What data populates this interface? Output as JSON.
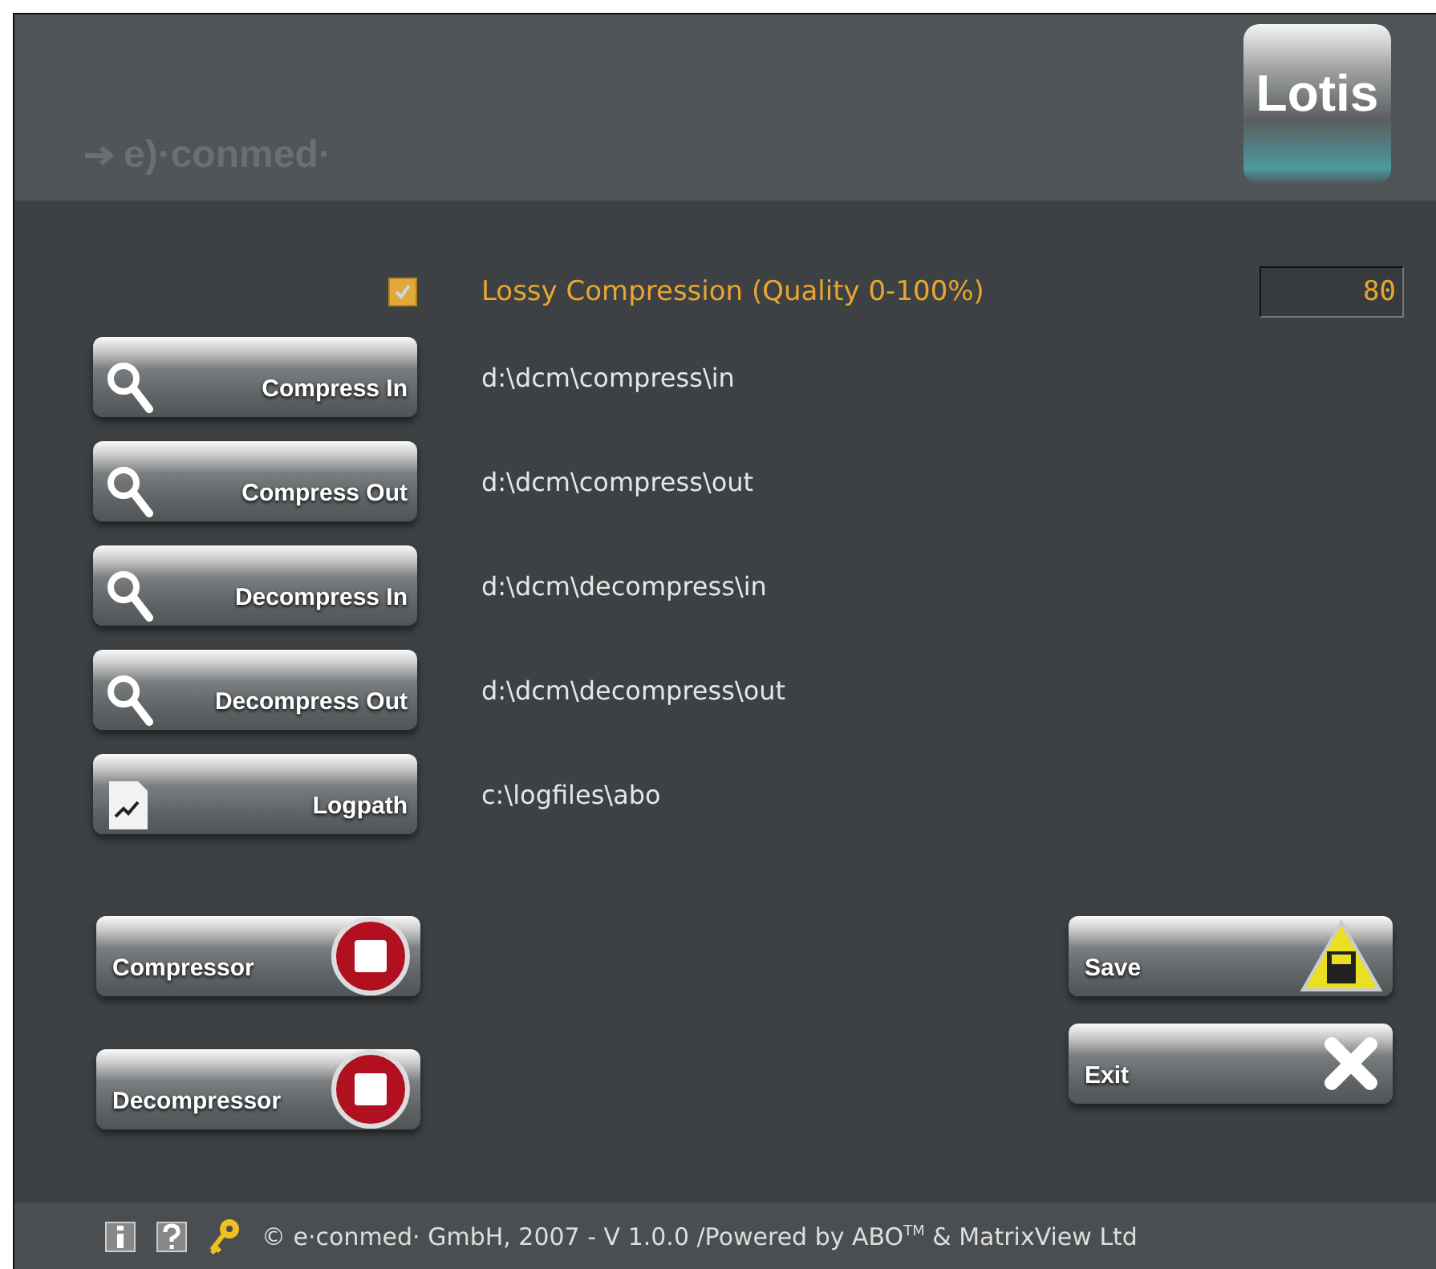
{
  "header": {
    "logo": "e)·conmed·",
    "app_badge": "Lotis"
  },
  "quality": {
    "checked": true,
    "label": "Lossy Compression (Quality 0-100%)",
    "value": "80"
  },
  "paths": [
    {
      "button": "Compress In",
      "kind": "search",
      "path": "d:\\dcm\\compress\\in"
    },
    {
      "button": "Compress Out",
      "kind": "search",
      "path": "d:\\dcm\\compress\\out"
    },
    {
      "button": "Decompress In",
      "kind": "search",
      "path": "d:\\dcm\\decompress\\in"
    },
    {
      "button": "Decompress Out",
      "kind": "search",
      "path": "d:\\dcm\\decompress\\out"
    },
    {
      "button": "Logpath",
      "kind": "log",
      "path": "c:\\logfiles\\abo"
    }
  ],
  "services": [
    {
      "label": "Compressor"
    },
    {
      "label": "Decompressor"
    }
  ],
  "actions": [
    {
      "label": "Save",
      "kind": "save"
    },
    {
      "label": "Exit",
      "kind": "exit"
    }
  ],
  "footer": {
    "text": "© e·conmed· GmbH, 2007 - V 1.0.0 /Powered by ABO$^{TM}$ & MatrixView Ltd"
  }
}
